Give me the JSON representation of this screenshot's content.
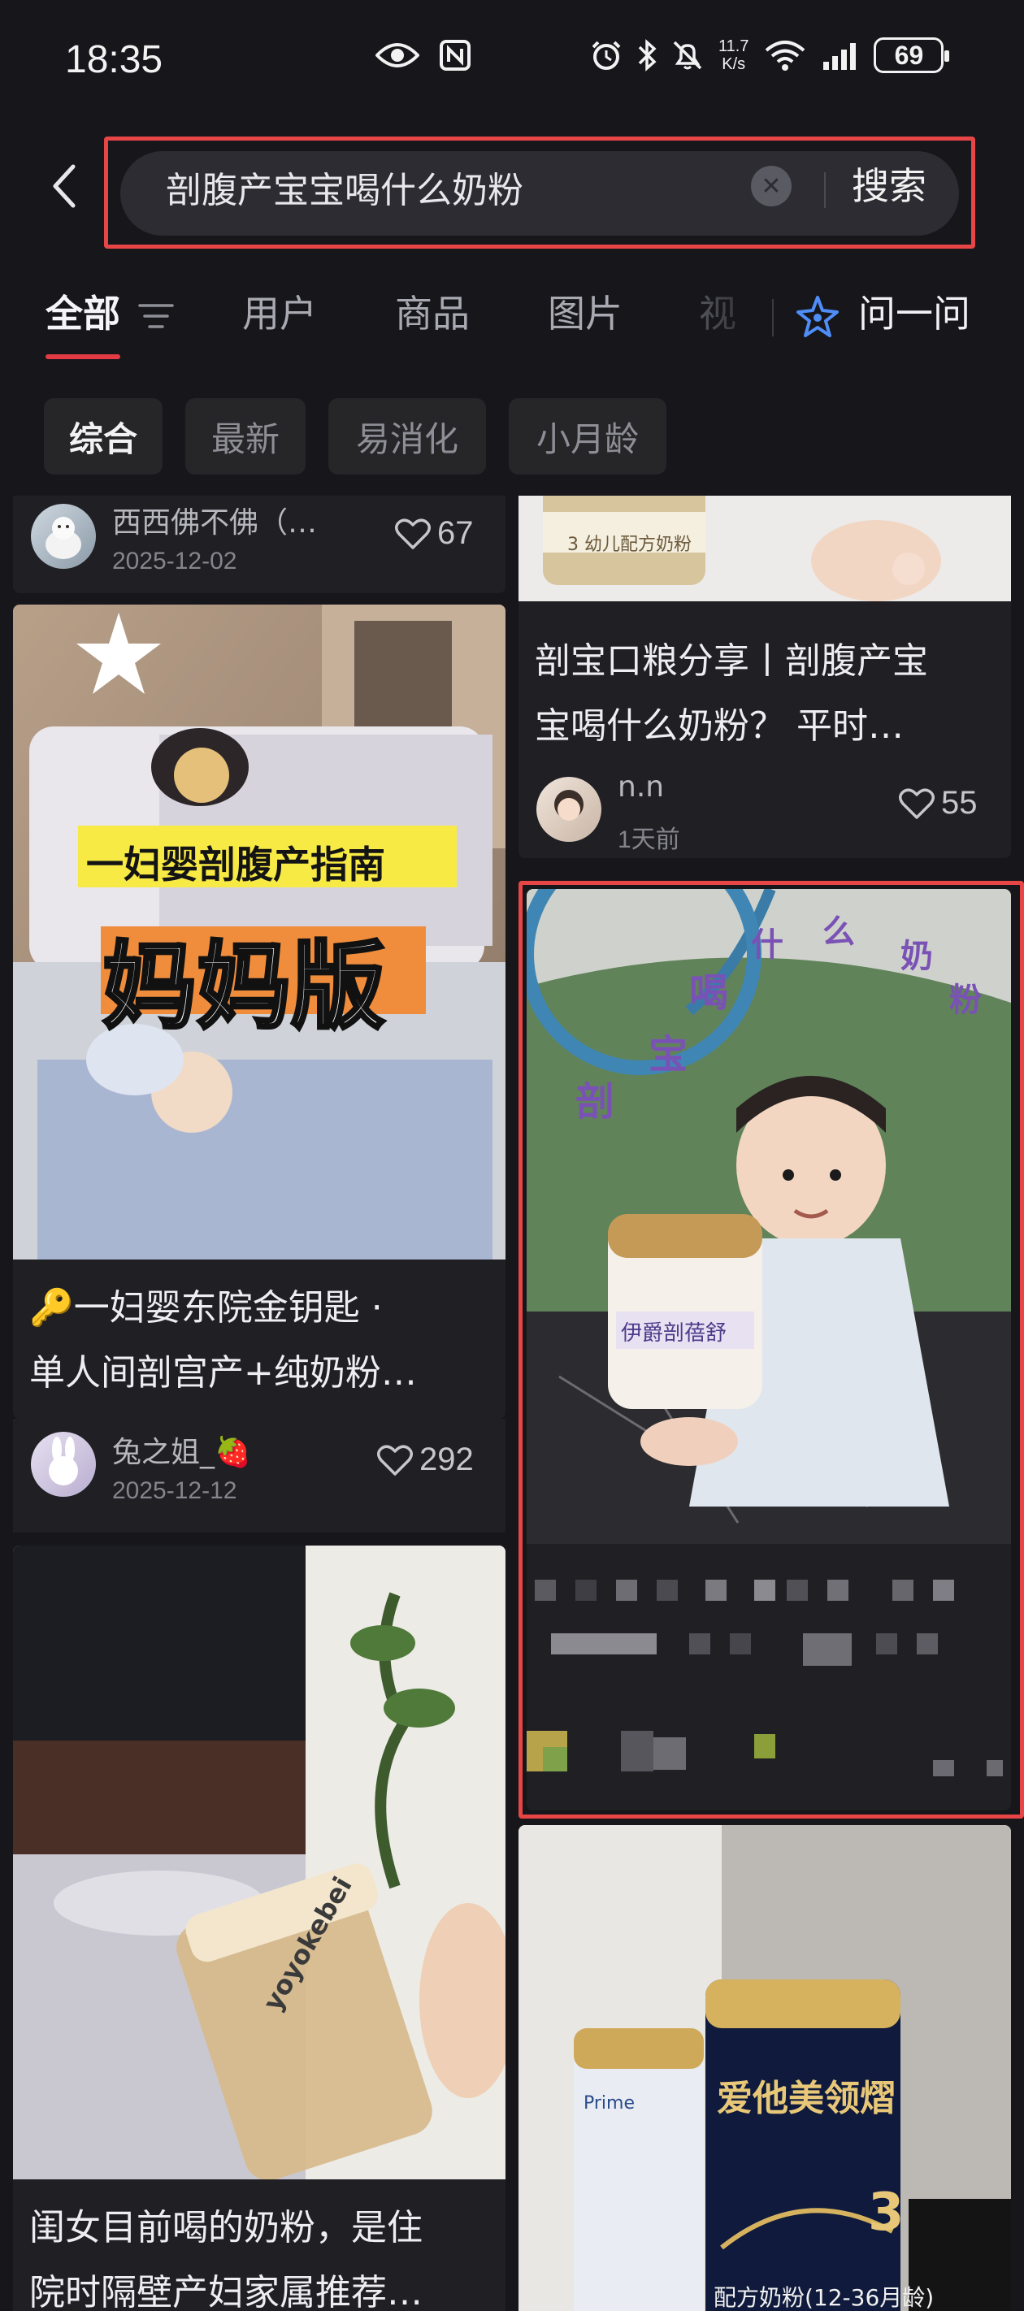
{
  "status_bar": {
    "time": "18:35",
    "net_speed_value": "11.7",
    "net_speed_unit": "K/s",
    "battery": "69",
    "icons": [
      "eye-icon",
      "nfc-icon",
      "alarm-icon",
      "bluetooth-icon",
      "mute-icon",
      "wifi-icon",
      "signal-icon",
      "battery-icon"
    ]
  },
  "search": {
    "query": "剖腹产宝宝喝什么奶粉",
    "submit_label": "搜索"
  },
  "tabs": [
    {
      "label": "全部",
      "active": true
    },
    {
      "label": "用户"
    },
    {
      "label": "商品"
    },
    {
      "label": "图片"
    },
    {
      "label": "视"
    }
  ],
  "ask": {
    "label": "问一问"
  },
  "chips": [
    {
      "label": "综合",
      "active": true
    },
    {
      "label": "最新"
    },
    {
      "label": "易消化"
    },
    {
      "label": "小月龄"
    }
  ],
  "feed": {
    "left": [
      {
        "author": "西西佛不佛（…",
        "date": "2025-12-02",
        "likes": "67"
      },
      {
        "image_title": "一妇婴剖腹产指南",
        "image_subtitle": "妈妈版",
        "title_line1": "🔑一妇婴东院金钥匙 ·",
        "title_line2": "单人间剖宫产+纯奶粉…",
        "author": "兔之姐_🍓",
        "date": "2025-12-12",
        "likes": "292"
      },
      {
        "image_text": "yoyokebei",
        "title_line1": "闺女目前喝的奶粉，是住",
        "title_line2": "院时隔壁产妇家属推荐…"
      }
    ],
    "right": [
      {
        "image_text": "3 幼儿配方奶粉",
        "title_line1": "剖宝口粮分享丨剖腹产宝",
        "title_line2": "宝喝什么奶粉？ 平时…",
        "author": "n.n",
        "date": "1天前",
        "likes": "55"
      },
      {
        "image_caption_chars": [
          "剖",
          "宝",
          "喝",
          "什",
          "么",
          "奶",
          "粉"
        ],
        "can_label": "伊爵剖蓓舒"
      },
      {
        "can_brand": "爱他美领熠",
        "can_stage": "3",
        "can_desc": "配方奶粉(12-36月龄)",
        "can2_text": "Prime"
      }
    ]
  },
  "colors": {
    "background": "#16161b",
    "card": "#1f1f24",
    "accent_red": "#e23b43",
    "highlight_frame": "#e84646"
  }
}
